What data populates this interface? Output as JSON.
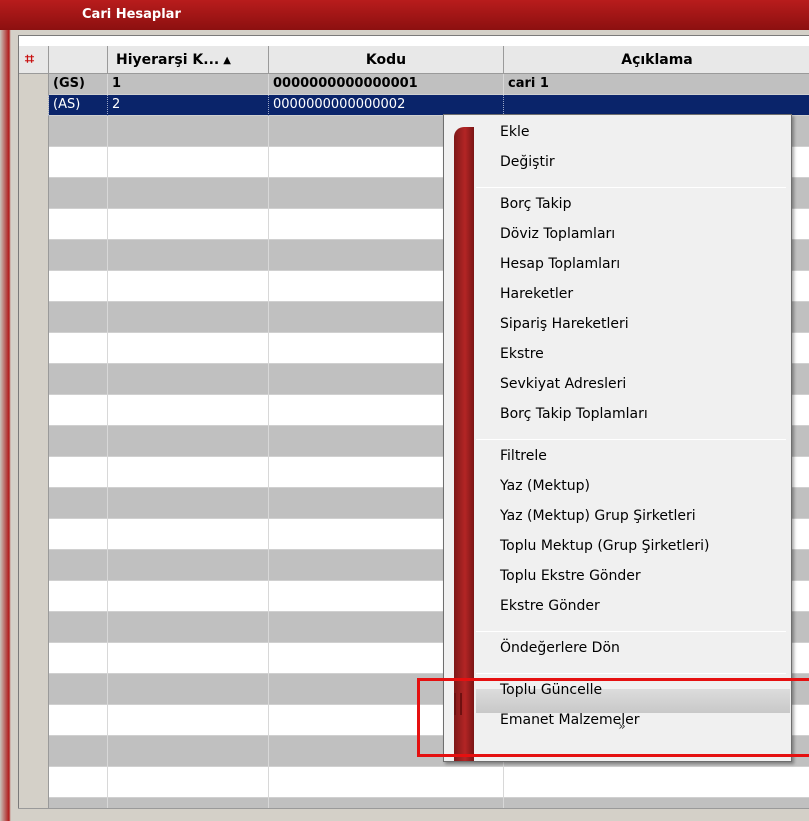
{
  "window": {
    "title": "Cari Hesaplar"
  },
  "grid": {
    "columns": [
      {
        "label": ""
      },
      {
        "label": ""
      },
      {
        "label": "Hiyerarşi K..."
      },
      {
        "label": "Kodu"
      },
      {
        "label": "Açıklama"
      }
    ],
    "rows": [
      {
        "type": "(GS)",
        "hier": "1",
        "code": "0000000000000001",
        "desc": "cari 1"
      },
      {
        "type": "(AS)",
        "hier": "2",
        "code": "0000000000000002",
        "desc": ""
      }
    ]
  },
  "context_menu": {
    "groups": [
      [
        "Ekle",
        "Değiştir"
      ],
      [
        "Borç Takip",
        "Döviz Toplamları",
        "Hesap Toplamları",
        "Hareketler",
        "Sipariş Hareketleri",
        "Ekstre",
        "Sevkiyat Adresleri",
        "Borç Takip Toplamları"
      ],
      [
        "Filtrele",
        "Yaz (Mektup)",
        "Yaz (Mektup) Grup Şirketleri",
        "Toplu Mektup  (Grup Şirketleri)",
        "Toplu Ekstre Gönder",
        "Ekstre Gönder"
      ],
      [
        "Öndeğerlere Dön"
      ],
      [
        "Toplu Güncelle",
        "Emanet Malzemeler"
      ]
    ],
    "hovered_item": "Emanet Malzemeler",
    "more_indicator": "»"
  },
  "colors": {
    "titlebar": "#a01515",
    "selected_row": "#0a246a",
    "highlight_box": "#e51010"
  }
}
